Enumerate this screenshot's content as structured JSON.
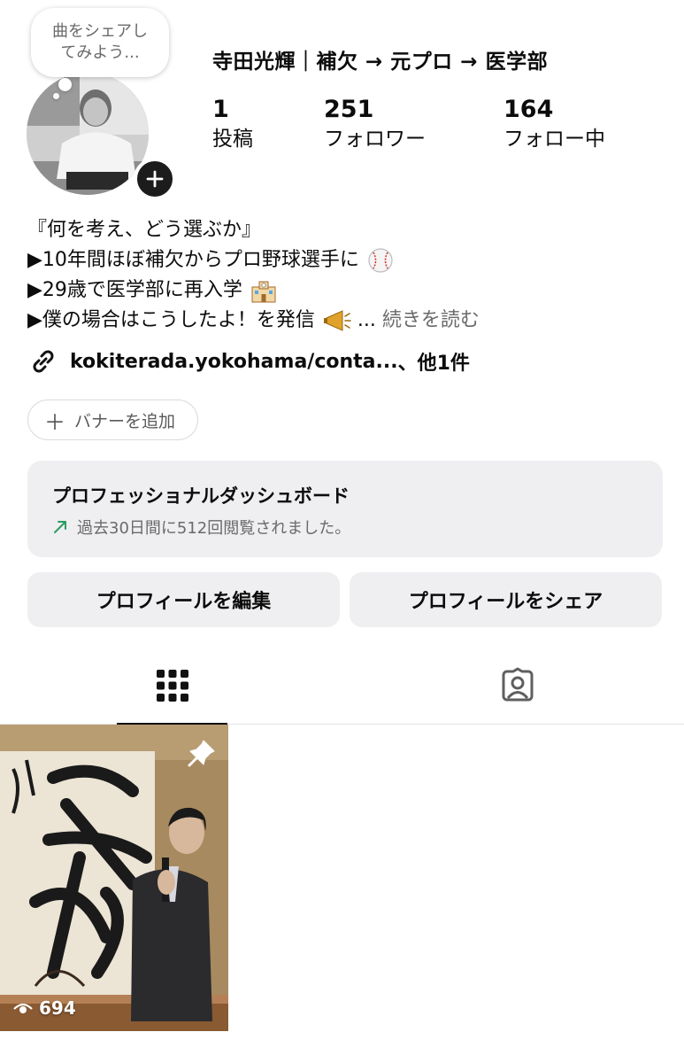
{
  "note": {
    "line1": "曲をシェアし",
    "line2": "てみよう..."
  },
  "profile": {
    "name": "寺田光輝｜補欠 → 元プロ → 医学部",
    "stats": [
      {
        "value": "1",
        "label": "投稿"
      },
      {
        "value": "251",
        "label": "フォロワー"
      },
      {
        "value": "164",
        "label": "フォロー中"
      }
    ]
  },
  "bio": {
    "line1": "『何を考え、どう選ぶか』",
    "line2": "▶10年間ほぼ補欠からプロ野球選手に",
    "line3": "▶29歳で医学部に再入学",
    "line4": "▶僕の場合はこうしたよ！を発信",
    "ellipsis": "... ",
    "more": "続きを読む",
    "emojis": [
      "baseball-icon",
      "school-icon",
      "megaphone-icon"
    ]
  },
  "link": {
    "text": "kokiterada.yokohama/conta...",
    "suffix": " 、他1件"
  },
  "banner_button": {
    "label": "バナーを追加"
  },
  "dashboard": {
    "title": "プロフェッショナルダッシュボード",
    "subtitle": "過去30日間に512回閲覧されました。",
    "trend_color": "#2e9c5e"
  },
  "buttons": {
    "edit": "プロフィールを編集",
    "share": "プロフィールをシェア"
  },
  "tabs": [
    {
      "icon": "grid-icon",
      "active": true
    },
    {
      "icon": "tagged-person-icon",
      "active": false
    }
  ],
  "posts": [
    {
      "views": "694",
      "pinned": true
    }
  ]
}
